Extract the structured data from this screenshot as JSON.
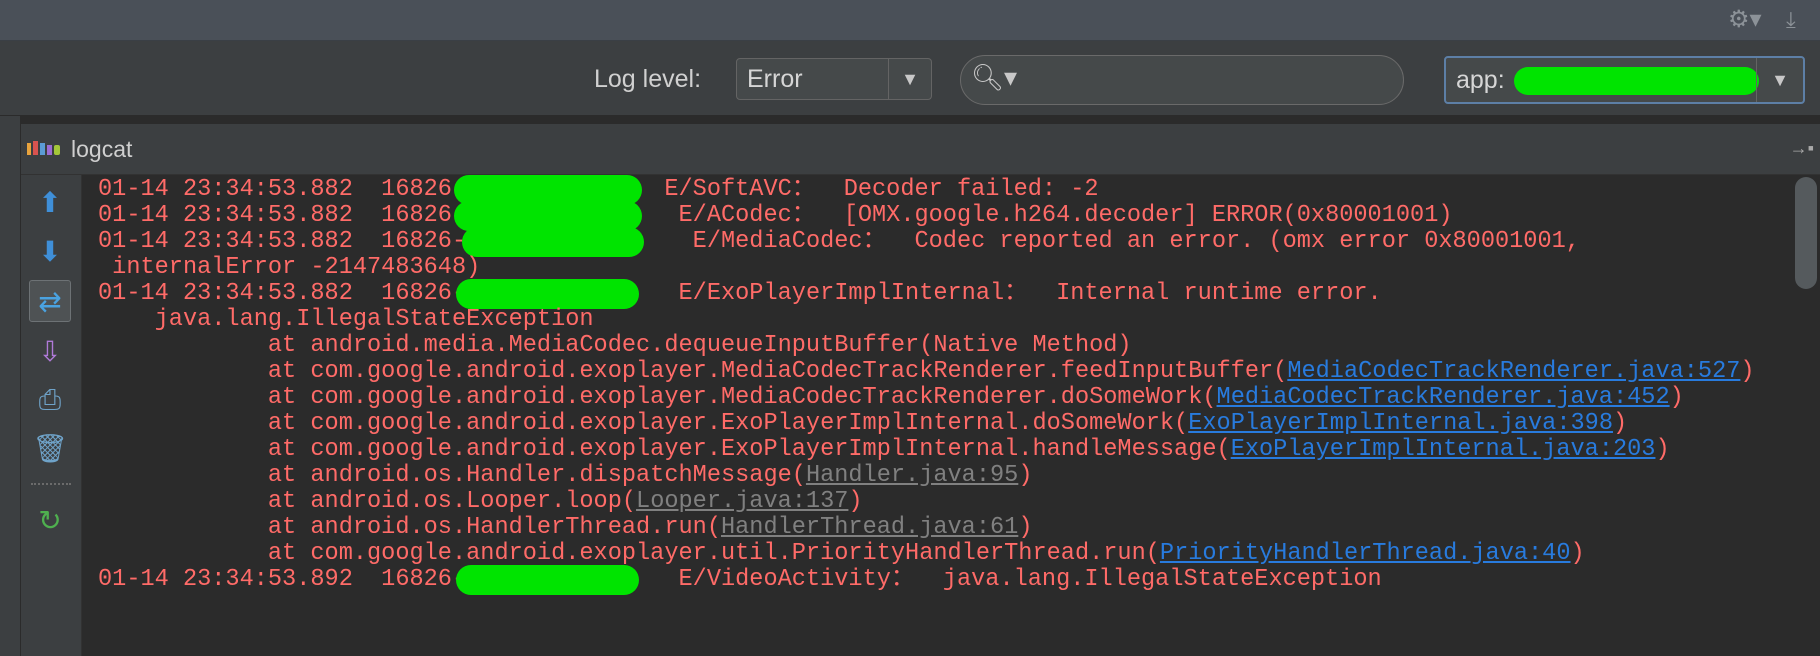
{
  "topbar": {
    "gear_icon": "⚙▾",
    "download_icon": "⤓"
  },
  "filter": {
    "log_level_label": "Log level:",
    "log_level_value": "Error",
    "search_icon": "🔍︎▾",
    "search_value": "",
    "app_filter_prefix": "app:"
  },
  "panel": {
    "title": "logcat",
    "pin_icon": "→▪"
  },
  "toolbar": {
    "up_icon": "⬆",
    "down_icon": "⬇",
    "soft_wrap_icon": "⇄",
    "export_icon": "⇩",
    "print_icon": "⎙",
    "clear_icon": "🗑︎",
    "restart_icon": "↻"
  },
  "log": {
    "lines": [
      {
        "prefix": "01-14 23:34:53.882  16826-1684",
        "tag": "E/SoftAVC：  Decoder failed: -2"
      },
      {
        "prefix": "01-14 23:34:53.882  16826-16848",
        "tag": "E/ACodec：  [OMX.google.h264.decoder] ERROR(0x80001001)"
      },
      {
        "prefix": "01-14 23:34:53.882  16826-16848/",
        "tag": "E/MediaCodec：  Codec reported an error. (omx error 0x80001001,"
      },
      {
        "text": " internalError -2147483648)"
      },
      {
        "prefix": "01-14 23:34:53.882  16826-16842",
        "tag": "E/ExoPlayerImplInternal：  Internal runtime error."
      },
      {
        "text": "    java.lang.IllegalStateException"
      },
      {
        "text": "            at android.media.MediaCodec.dequeueInputBuffer(Native Method)"
      },
      {
        "text": "            at com.google.android.exoplayer.MediaCodecTrackRenderer.feedInputBuffer(",
        "link": "MediaCodecTrackRenderer.java:527",
        "suffix": ")"
      },
      {
        "text": "            at com.google.android.exoplayer.MediaCodecTrackRenderer.doSomeWork(",
        "link": "MediaCodecTrackRenderer.java:452",
        "suffix": ")"
      },
      {
        "text": "            at com.google.android.exoplayer.ExoPlayerImplInternal.doSomeWork(",
        "link": "ExoPlayerImplInternal.java:398",
        "suffix": ")"
      },
      {
        "text": "            at com.google.android.exoplayer.ExoPlayerImplInternal.handleMessage(",
        "link": "ExoPlayerImplInternal.java:203",
        "suffix": ")"
      },
      {
        "text": "            at android.os.Handler.dispatchMessage(",
        "link_gray": "Handler.java:95",
        "suffix": ")"
      },
      {
        "text": "            at android.os.Looper.loop(",
        "link_gray": "Looper.java:137",
        "suffix": ")"
      },
      {
        "text": "            at android.os.HandlerThread.run(",
        "link_gray": "HandlerThread.java:61",
        "suffix": ")"
      },
      {
        "text": "            at com.google.android.exoplayer.util.PriorityHandlerThread.run(",
        "link": "PriorityHandlerThread.java:40",
        "suffix": ")"
      },
      {
        "prefix": "01-14 23:34:53.892  16826-16826",
        "tag": "E/VideoActivity：  java.lang.IllegalStateException"
      }
    ]
  },
  "colors": {
    "error_text": "#ff6b68",
    "link": "#287bde",
    "link_gray": "#808080",
    "redaction": "#00e400",
    "background": "#2b2b2b",
    "chrome": "#3c3f41"
  }
}
